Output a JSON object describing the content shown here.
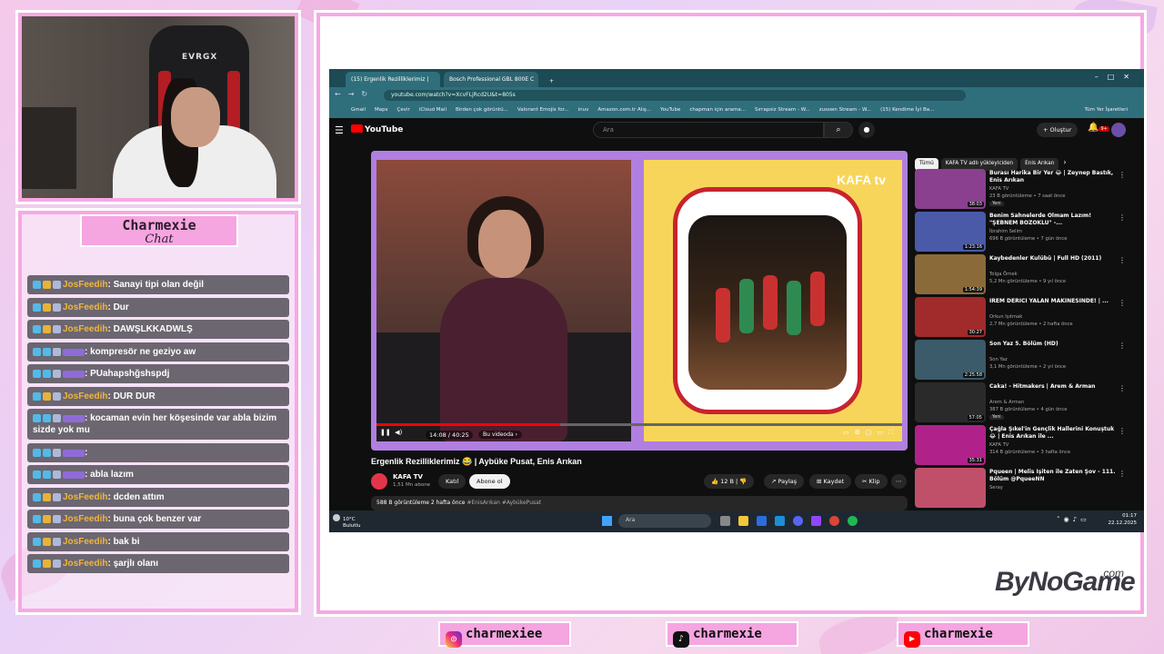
{
  "overlay": {
    "chat_title": "Charmexie",
    "chat_subtitle": "Chat",
    "brand": "ByNoGame",
    "brand_suffix": ".com",
    "socials": [
      {
        "icon": "instagram-icon",
        "handle": "charmexiee"
      },
      {
        "icon": "tiktok-icon",
        "handle": "charmexie"
      },
      {
        "icon": "youtube-icon",
        "handle": "charmexie"
      }
    ],
    "chair_brand": "EVRGX"
  },
  "chat": {
    "messages": [
      {
        "user": "JosFeedih",
        "text": ": Sanayi tipi olan değil"
      },
      {
        "user": "JosFeedih",
        "text": ": Dur"
      },
      {
        "user": "JosFeedih",
        "text": ": DAWŞLKKADWLŞ"
      },
      {
        "user": "",
        "text": ": kompresör ne geziyo aw"
      },
      {
        "user": "",
        "text": ": PUahapshğshspdj"
      },
      {
        "user": "JosFeedih",
        "text": ": DUR DUR"
      },
      {
        "user": "",
        "text": ": kocaman evin her köşesinde var abla bizim sizde yok mu"
      },
      {
        "user": "",
        "text": ":"
      },
      {
        "user": "",
        "text": ": abla lazım"
      },
      {
        "user": "JosFeedih",
        "text": ": dcden attım"
      },
      {
        "user": "JosFeedih",
        "text": ": buna çok benzer var"
      },
      {
        "user": "JosFeedih",
        "text": ": bak bi"
      },
      {
        "user": "JosFeedih",
        "text": ": şarjlı olanı"
      }
    ]
  },
  "browser": {
    "tabs": [
      "(15) Ergenlik Rezilliklerimiz |",
      "Bosch Professional GBL 800E C"
    ],
    "new_tab": "+",
    "url": "youtube.com/watch?v=XcvFLjRcd2U&t=805s",
    "bookmarks": [
      "Gmail",
      "Maps",
      "Çevir",
      "iCloud Mail",
      "Birden çok görüntü...",
      "Valorant Emojis for...",
      "inuv",
      "Amazon.com.tr Alış...",
      "YouTube",
      "chapman için arama...",
      "Sırrapsiz Stream - W...",
      "zusswn Stream - W...",
      "(15) Kendime İyi Ba..."
    ],
    "bookmarks_right": "Tüm Yer İşaretleri"
  },
  "youtube": {
    "logo": "YouTube",
    "search_placeholder": "Ara",
    "create_label": "Oluştur",
    "notif_count": "9+",
    "video": {
      "title": "Ergenlik Rezilliklerimiz 😂 | Aybüke Pusat, Enis Arıkan",
      "time": "14:08 / 40:25",
      "chapter": "Bu videoda ›",
      "progress": 0.35,
      "overlay_logo": "KAFA tv"
    },
    "channel": {
      "name": "KAFA TV",
      "subs": "1,51 Mn abone",
      "join": "Katıl",
      "subscribe": "Abone ol"
    },
    "actions": {
      "likes": "12 B",
      "share": "Paylaş",
      "save": "Kaydet",
      "clip": "Klip"
    },
    "description": {
      "stats": "588 B görüntüleme  2 hafta önce",
      "tags": "#EnisArıkan #AybükePusat"
    },
    "chips": [
      "Tümü",
      "KAFA TV adlı yükleyiciden",
      "Enis Arıkan"
    ],
    "recommendations": [
      {
        "title": "Burası Harika Bir Yer 😂 | Zeynep Bastık, Enis Arıkan",
        "channel": "KAFA TV",
        "meta": "23 B görüntüleme • 7 saat önce",
        "duration": "38:03",
        "new": "Yeni",
        "thumb_color": "#8a3f8f"
      },
      {
        "title": "Benim Sahnelerde Olmam Lazım! \"ŞEBNEM BOZOKLU\" -...",
        "channel": "İbrahim Selim",
        "meta": "696 B görüntüleme • 7 gün önce",
        "duration": "1:23:16",
        "new": "",
        "thumb_color": "#4a5aa8"
      },
      {
        "title": "Kaybedenler Kulübü | Full HD (2011)",
        "channel": "Tolga Örnek",
        "meta": "5,2 Mn görüntüleme • 9 yıl önce",
        "duration": "1:54:39",
        "new": "",
        "thumb_color": "#8b6a3a"
      },
      {
        "title": "İREM DERİCİ YALAN MAKİNESİNDE! | ...",
        "channel": "Orkun Işıtmak",
        "meta": "2,7 Mn görüntüleme • 2 hafta önce",
        "duration": "30:27",
        "new": "",
        "thumb_color": "#a12a2a"
      },
      {
        "title": "Son Yaz 5. Bölüm (HD)",
        "channel": "Son Yaz",
        "meta": "3,1 Mn görüntüleme • 2 yıl önce",
        "duration": "2:25:58",
        "new": "",
        "thumb_color": "#3b5a6a"
      },
      {
        "title": "Caka! - Hitmakers | Arem & Arman",
        "channel": "Arem & Arman",
        "meta": "387 B görüntüleme • 4 gün önce",
        "duration": "57:05",
        "new": "Yeni",
        "thumb_color": "#2a2a2a"
      },
      {
        "title": "Çağla Şıkel'in Gençlik Hallerini Konuştuk 😂 | Enis Arıkan ile ...",
        "channel": "KAFA TV",
        "meta": "314 B görüntüleme • 3 hafta önce",
        "duration": "35:31",
        "new": "",
        "thumb_color": "#b0228a"
      },
      {
        "title": "Pqueen | Melis İşiten ile Zaten Şov - 111. Bölüm @PqueeNN",
        "channel": "Seray",
        "meta": "",
        "duration": "",
        "new": "",
        "thumb_color": "#c0506a"
      }
    ]
  },
  "taskbar": {
    "temp": "10°C",
    "weather": "Bulutlu",
    "search": "Ara",
    "time": "01:17",
    "date": "22.12.2025"
  },
  "colors": {
    "accent_pink": "#f7a8e3",
    "youtube_red": "#ff0000",
    "chat_gold": "#f2b53b",
    "chat_purple": "#9b6df0"
  }
}
